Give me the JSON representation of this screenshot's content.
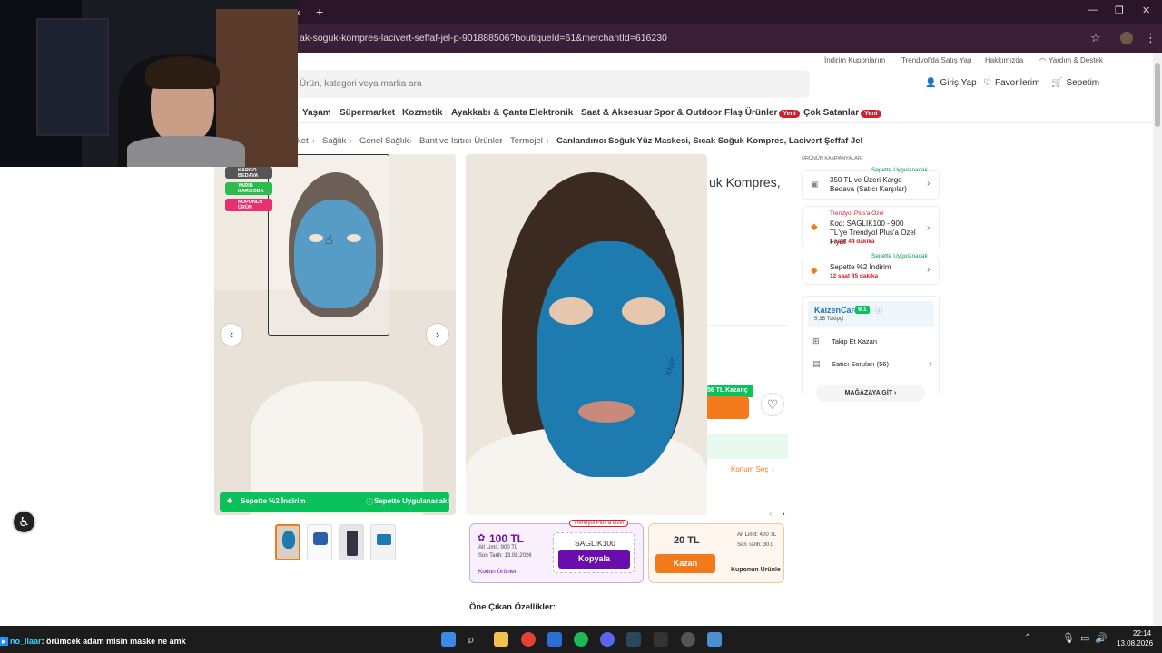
{
  "browser": {
    "url": "ak-soguk-kompres-lacivert-seffaf-jel-p-901888506?boutiqueId=61&merchantId=616230",
    "tab_controls": [
      "‹",
      "+"
    ],
    "window_controls": [
      "—",
      "❐",
      "✕"
    ]
  },
  "header": {
    "top_links": [
      "İndirim Kuponlarım",
      "Trendyol'da Satış Yap",
      "Hakkımızda",
      "Yardım & Destek"
    ],
    "search_placeholder": "Ürün, kategori veya marka ara",
    "login": "Giriş Yap",
    "favorites": "Favorilerim",
    "cart": "Sepetim"
  },
  "nav": {
    "items": [
      "Yaşam",
      "Süpermarket",
      "Kozmetik",
      "Ayakkabı & Çanta",
      "Elektronik",
      "Saat & Aksesuar",
      "Spor & Outdoor",
      "Flaş Ürünler",
      "Çok Satanlar"
    ],
    "new_badge": "Yeni"
  },
  "breadcrumb": [
    "ket",
    "Sağlık",
    "Genel Sağlık",
    "Bant ve Isıtıcı Ürünler",
    "Termojel",
    "Canlandırıcı Soğuk Yüz Maskesi, Sıcak Soğuk Kompres, Lacivert Şeffaf Jel"
  ],
  "product": {
    "title_fragment": "uk Kompres,",
    "badges": [
      "KARGO BEDAVA",
      "YARIN KARGODA",
      "KUPONLU ÜRÜN"
    ],
    "bottom_banner_left": "Sepette %2 İndirim",
    "bottom_banner_right": "Sepette Uygulanacak!",
    "earn_badge": "56 TL Kazanç",
    "location": "Konum Seç",
    "mask_text": "XMP"
  },
  "campaigns": {
    "title": "ÜRÜNÜN KAMPANYALARI",
    "items": [
      {
        "tag": "Sepette Uygulanacak",
        "text": "350 TL ve Üzeri Kargo Bedava (Satıcı Karşılar)",
        "time": ""
      },
      {
        "tag": "Trendyol Plus'a Özel",
        "text": "Kod: SAGLIK100 - 900 TL'ye Trendyol Plus'a Özel Fiyat",
        "time": "1 saat 44 dakika"
      },
      {
        "tag": "Sepette Uygulanacak",
        "text": "Sepette %2 İndirim",
        "time": "12 saat 45 dakika"
      }
    ]
  },
  "seller": {
    "name": "KaizenCare",
    "rating": "9.1",
    "followers": "5,3B Takipçi",
    "follow": "Takip Et Kazan",
    "questions": "Satıcı Soruları (56)",
    "store_btn": "MAĞAZAYA GİT"
  },
  "coupons": [
    {
      "amount": "100 TL",
      "limit": "Alt Limit: 900 TL",
      "date": "Son Tarih: 13.08.2026",
      "link": "Kodun Ürünleri",
      "tag": "Trendyol Plus'a Özel",
      "code": "SAGLIK100",
      "btn": "Kopyala"
    },
    {
      "amount": "20 TL",
      "btn": "Kazan",
      "limit": "Alt Limit: 400 TL",
      "date": "Son Tarih: 30.0",
      "link": "Kuponun Ürünle"
    }
  ],
  "features_title": "Öne Çıkan Özellikler:",
  "chat": {
    "user": "no_llaar",
    "message": ": örümcek adam misin maske ne amk"
  },
  "taskbar": {
    "time": "22:14",
    "date": "13.08.2026"
  },
  "colors": {
    "brand": "#f27a1a",
    "green": "#0bc15c",
    "plus": "#6a0dad",
    "mask": "#1e7bb0"
  }
}
